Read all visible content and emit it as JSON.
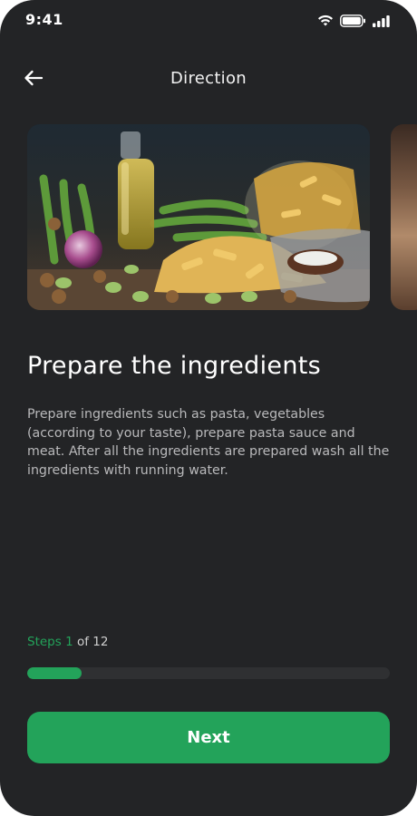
{
  "status_bar": {
    "time": "9:41",
    "icons": [
      "wifi-icon",
      "battery-icon",
      "signal-icon"
    ]
  },
  "header": {
    "back_icon": "arrow-left-icon",
    "title": "Direction"
  },
  "carousel": {
    "images": [
      "pasta-ingredients-photo",
      "next-step-photo-preview"
    ]
  },
  "step": {
    "title": "Prepare the ingredients",
    "description": "Prepare ingredients such as pasta, vegetables (according to your taste), prepare pasta sauce and meat. After all the ingredients are prepared wash all the ingredients with running water."
  },
  "progress": {
    "label_prefix": "Steps",
    "current": "1",
    "label_suffix": "of 12",
    "fraction": 0.15
  },
  "actions": {
    "next_label": "Next"
  },
  "colors": {
    "background": "#232426",
    "accent": "#23a35a",
    "track": "#2f3032",
    "text_secondary": "#b9b9bb"
  }
}
